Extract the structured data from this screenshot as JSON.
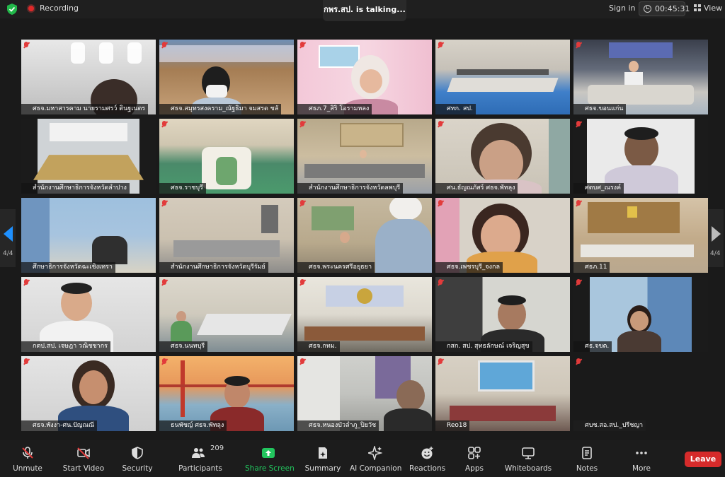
{
  "topbar": {
    "recording_label": "Recording",
    "talking_label": "กพร.สป. is talking...",
    "signin_label": "Sign in",
    "timer": "00:45:31",
    "view_label": "View"
  },
  "pagination": {
    "left": "4/4",
    "right": "4/4"
  },
  "tiles": [
    {
      "label": "ศธจ.มหาสารคาม นายรามศรว์ ตินฐเนตร"
    },
    {
      "label": "ศธจ.สมุทรสงคราม_ณัฐธิมา จมสรด ชลั"
    },
    {
      "label": "ศธภ.7_สิริ โอรามหลง"
    },
    {
      "label": "ศทก. สป."
    },
    {
      "label": "ศธจ.ขอนแก่น"
    },
    {
      "label": "สำนักงานศึกษาธิการจังหวัดลำปาง"
    },
    {
      "label": "ศธจ.ราชบุรี"
    },
    {
      "label": "สำนักงานศึกษาธิการจังหวัดลพบุรี"
    },
    {
      "label": "ศน.ธัญณภัสร์ ศธจ.พัทลุง"
    },
    {
      "label": "ศตบศ_ณรงค์"
    },
    {
      "label": "ศึกษาธิการจังหวัดฉะเชิงเทรา"
    },
    {
      "label": "สำนักงานศึกษาธิการจังหวัดบุรีรัมย์"
    },
    {
      "label": "ศธจ.พระนครศรีอยุธยา"
    },
    {
      "label": "ศธจ.เพชรบุรี_จงกล"
    },
    {
      "label": "ศธภ.11"
    },
    {
      "label": "กตป.สป. เจษฎา วณิชชากร"
    },
    {
      "label": "ศธจ.นนทบุรี"
    },
    {
      "label": "ศธจ.กทม."
    },
    {
      "label": "กสก. สป. สุทธลักษณ์ เจริญสุข"
    },
    {
      "label": "ศธ.จขต."
    },
    {
      "label": "ศธจ.พังงา-ศน.ปัญณณี"
    },
    {
      "label": "ธนพัชญ์ ศธจ.พัทลุง"
    },
    {
      "label": "ศธจ.หนองบัวลำภู_ปิยวัช"
    },
    {
      "label": "Reo18"
    },
    {
      "label": "ศบช.สอ.สป._ปรีชญา"
    }
  ],
  "toolbar": {
    "unmute": "Unmute",
    "start_video": "Start Video",
    "security": "Security",
    "participants": "Participants",
    "participant_count": "209",
    "share_screen": "Share Screen",
    "summary": "Summary",
    "ai_companion": "AI Companion",
    "reactions": "Reactions",
    "apps": "Apps",
    "whiteboards": "Whiteboards",
    "notes": "Notes",
    "more": "More",
    "leave": "Leave"
  },
  "colors": {
    "share_green": "#22c55e",
    "leave_red": "#d62b2b",
    "nav_blue": "#1e90ff",
    "recording_red": "#e02828"
  }
}
